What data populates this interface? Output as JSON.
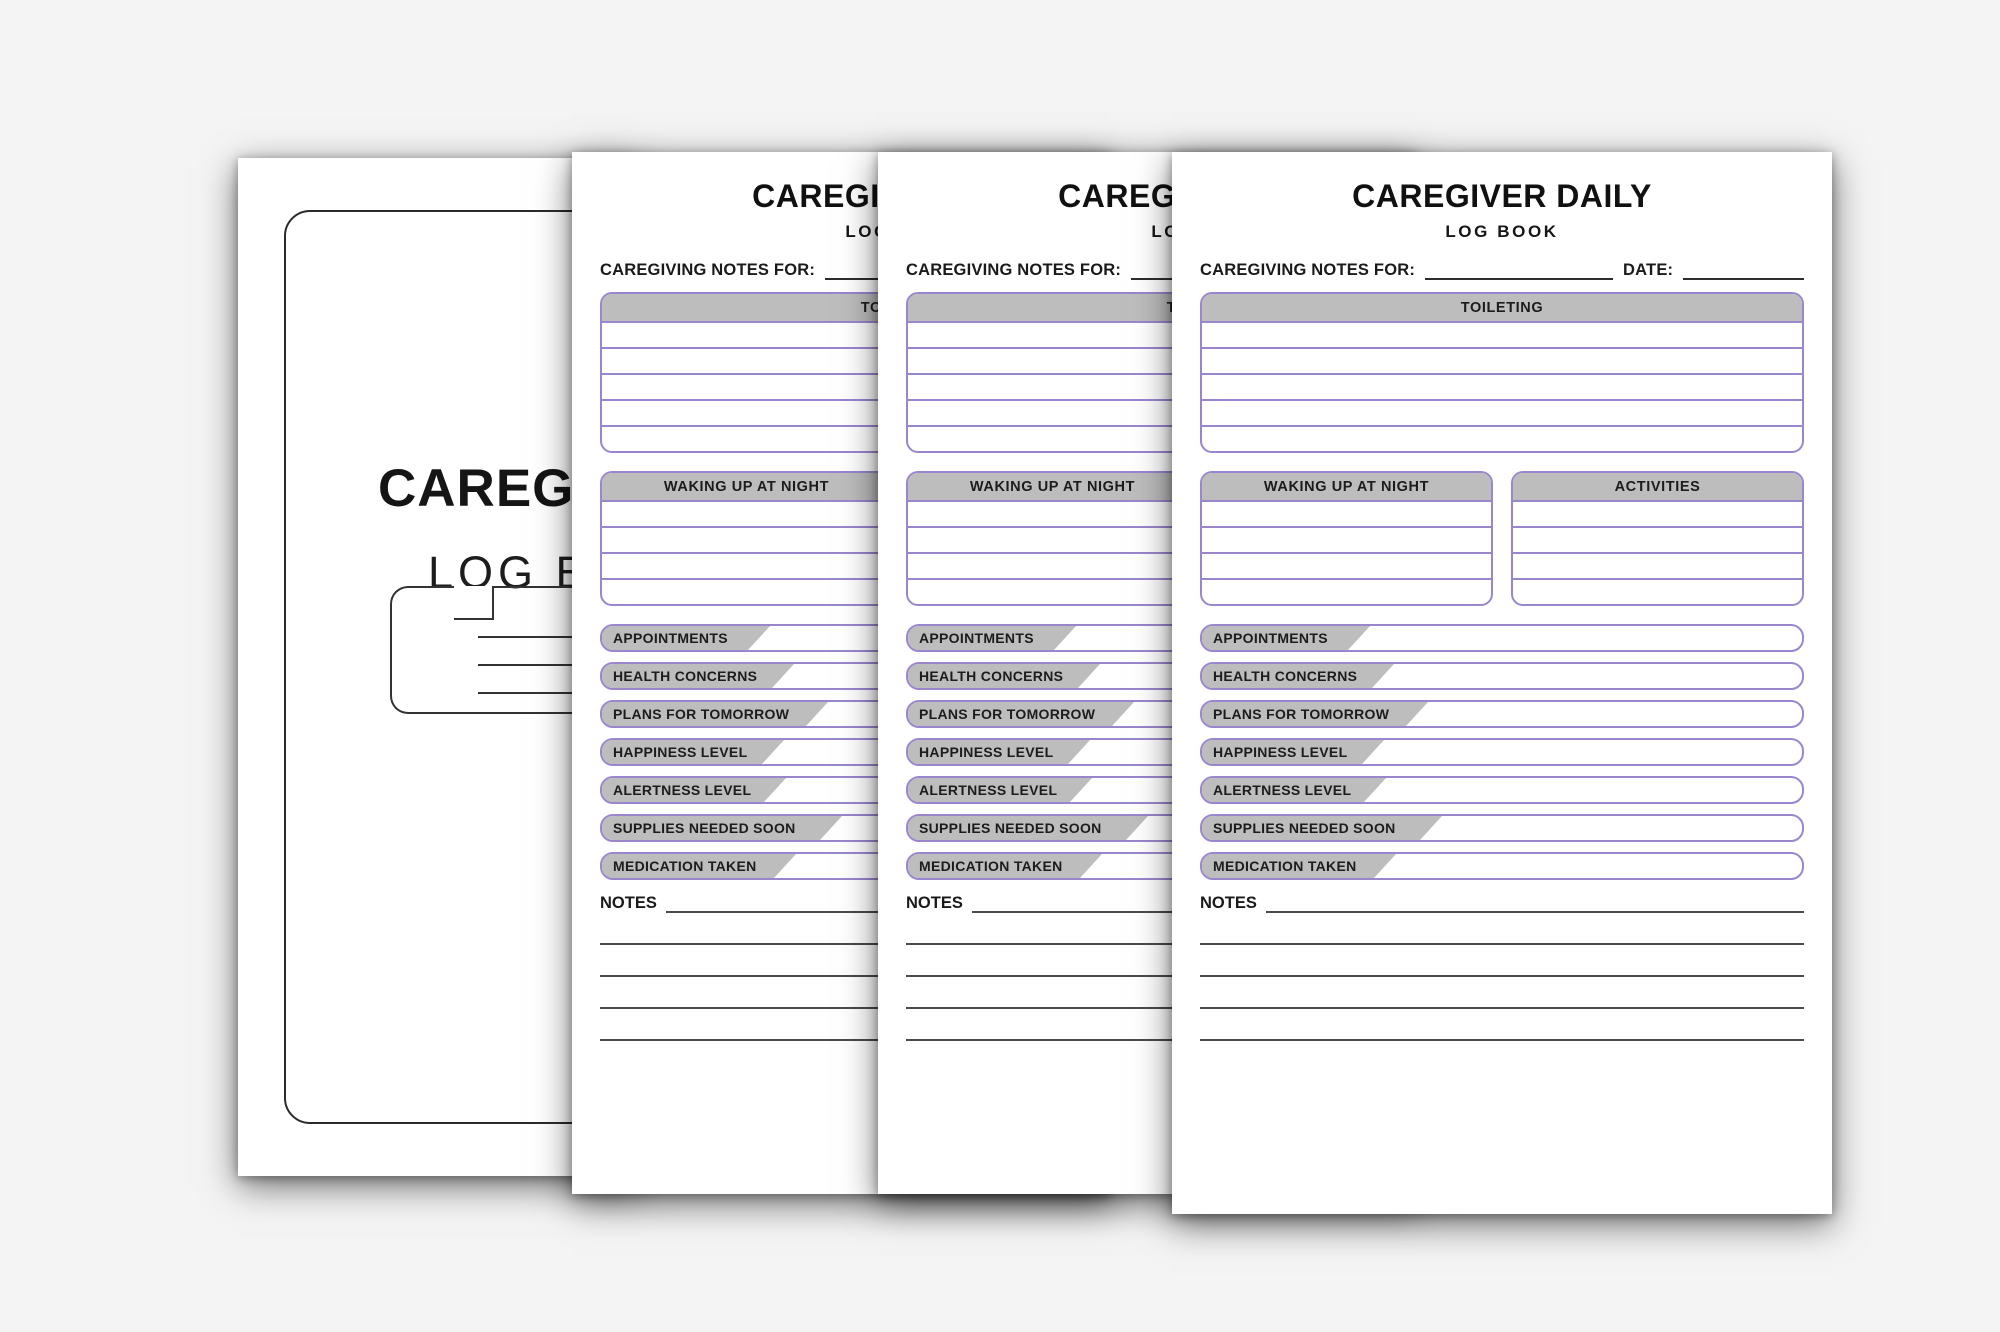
{
  "canvas": {
    "background": "#f4f4f4"
  },
  "palette": {
    "accent_purple": "#9a86cf",
    "header_gray": "#bdbdbd",
    "ink": "#1a1a1a",
    "rule": "#4a4a4a"
  },
  "cover": {
    "title": "CAREGIVER",
    "subtitle": "LOG BOOK"
  },
  "form": {
    "title": "CAREGIVER DAILY",
    "subtitle": "LOG BOOK",
    "meta": {
      "notes_for_label": "CAREGIVING NOTES FOR:",
      "date_label": "DATE:"
    },
    "toileting": {
      "header": "TOILETING",
      "line_count": 5
    },
    "columns": [
      {
        "header": "WAKING UP AT NIGHT",
        "line_count": 4
      },
      {
        "header": "ACTIVITIES",
        "line_count": 4
      }
    ],
    "tab_rows": [
      {
        "label": "APPOINTMENTS",
        "chip_width": 168
      },
      {
        "label": "HEALTH CONCERNS",
        "chip_width": 192
      },
      {
        "label": "PLANS FOR TOMORROW",
        "chip_width": 226
      },
      {
        "label": "HAPPINESS LEVEL",
        "chip_width": 182
      },
      {
        "label": "ALERTNESS LEVEL",
        "chip_width": 184
      },
      {
        "label": "SUPPLIES NEEDED SOON",
        "chip_width": 240
      },
      {
        "label": "MEDICATION TAKEN",
        "chip_width": 194
      }
    ],
    "notes": {
      "label": "NOTES",
      "extra_line_count": 4
    }
  }
}
